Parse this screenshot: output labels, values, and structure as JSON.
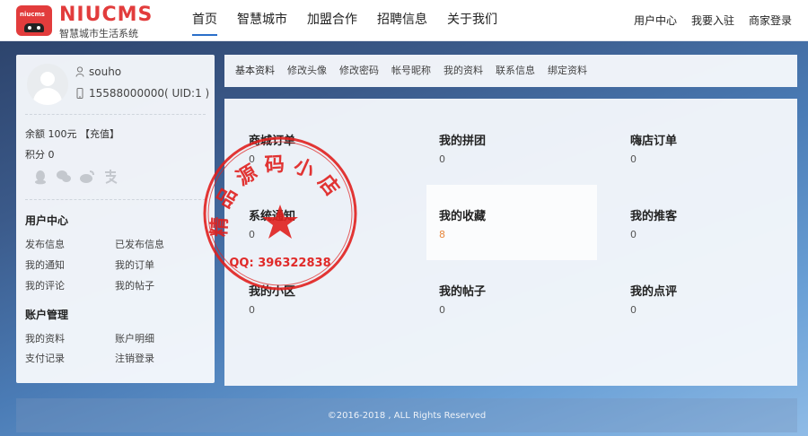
{
  "header": {
    "logo_mini": "niucms",
    "brand_name": "NIUCMS",
    "brand_sub": "智慧城市生活系统",
    "nav": [
      "首页",
      "智慧城市",
      "加盟合作",
      "招聘信息",
      "关于我们"
    ],
    "top_links": [
      "用户中心",
      "我要入驻",
      "商家登录"
    ]
  },
  "profile": {
    "username": "souho",
    "phone_uid": "15588000000( UID:1 )",
    "balance": "余额 100元 【充值】",
    "points": "积分 0",
    "social_icons": [
      "qq-icon",
      "wechat-icon",
      "weibo-icon",
      "alipay-icon"
    ]
  },
  "user_center": {
    "title": "用户中心",
    "links": [
      "发布信息",
      "已发布信息",
      "我的通知",
      "我的订单",
      "我的评论",
      "我的帖子"
    ]
  },
  "account": {
    "title": "账户管理",
    "links": [
      "我的资料",
      "账户明细",
      "支付记录",
      "注销登录"
    ]
  },
  "tabs": [
    "基本资料",
    "修改头像",
    "修改密码",
    "帐号昵称",
    "我的资料",
    "联系信息",
    "绑定资料"
  ],
  "cards": [
    {
      "title": "商城订单",
      "value": "0"
    },
    {
      "title": "我的拼团",
      "value": "0"
    },
    {
      "title": "嗨店订单",
      "value": "0"
    },
    {
      "title": "系统通知",
      "value": "0"
    },
    {
      "title": "我的收藏",
      "value": "8"
    },
    {
      "title": "我的推客",
      "value": "0"
    },
    {
      "title": "我的小区",
      "value": "0"
    },
    {
      "title": "我的帖子",
      "value": "0"
    },
    {
      "title": "我的点评",
      "value": "0"
    }
  ],
  "stamp": {
    "text": "精品源码小店",
    "qq": "QQ: 396322838",
    "color": "#e0201e"
  },
  "footer": "©2016-2018 , ALL Rights Reserved",
  "colors": {
    "brand": "#e23c3c",
    "nav_active": "#2a6fc9",
    "accent_value": "#e7883e"
  }
}
